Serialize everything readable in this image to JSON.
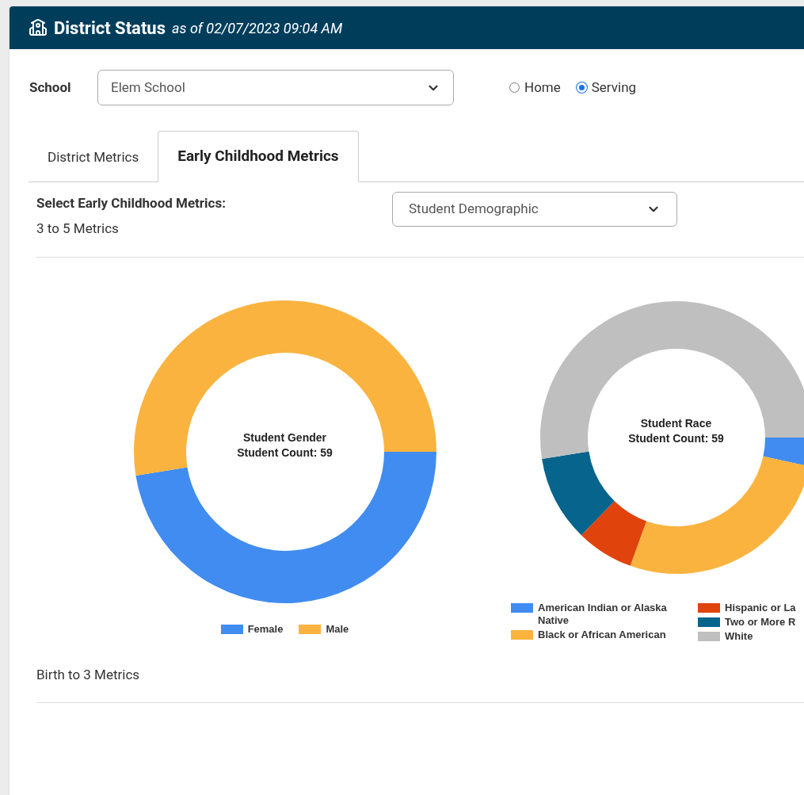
{
  "header": {
    "title": "District Status",
    "subtitle": "as of 02/07/2023 09:04 AM"
  },
  "school": {
    "label": "School",
    "value": "Elem School"
  },
  "view_options": [
    {
      "label": "Home",
      "selected": false
    },
    {
      "label": "Serving",
      "selected": true
    }
  ],
  "tabs": [
    {
      "label": "District Metrics",
      "selected": false
    },
    {
      "label": "Early Childhood Metrics",
      "selected": true
    }
  ],
  "metrics_select": {
    "label": "Select Early Childhood Metrics:",
    "value": "Student Demographic"
  },
  "sections": [
    {
      "title": "3 to 5 Metrics",
      "charts": [
        {
          "title": "Student Gender",
          "subtitle": "Student Count: 59",
          "chart_data": {
            "type": "donut",
            "legend": "bottom",
            "categories": [
              "Female",
              "Male"
            ],
            "colors": [
              "#418cf0",
              "#fbb33f"
            ],
            "values": [
              47.5,
              52.5
            ]
          }
        },
        {
          "title": "Student Race",
          "subtitle": "Student Count: 59",
          "chart_data": {
            "type": "donut",
            "legend": "bottom",
            "categories": [
              "American Indian or Alaska Native",
              "Black or African American",
              "Hispanic or La",
              "Two or More R",
              "White"
            ],
            "colors": [
              "#418cf0",
              "#fbb33f",
              "#e0430c",
              "#07648d",
              "#bfbfbf"
            ],
            "values": [
              3.4,
              27.1,
              6.8,
              10.2,
              52.5
            ]
          }
        }
      ]
    },
    {
      "title": "Birth to 3 Metrics"
    }
  ]
}
